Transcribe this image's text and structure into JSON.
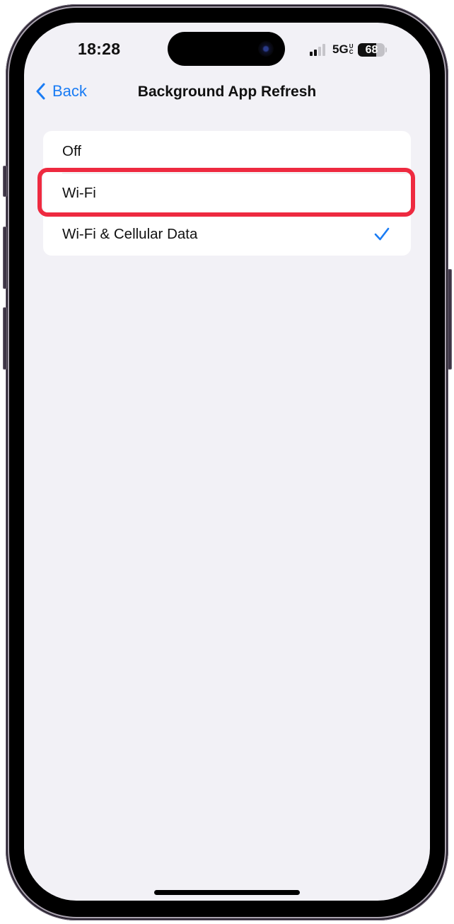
{
  "status_bar": {
    "time": "18:28",
    "signal_bars_active": 2,
    "signal_bars_total": 4,
    "network": "5G",
    "network_suffix_top": "U",
    "network_suffix_bottom": "C",
    "battery_percent": 68,
    "battery_label": "68"
  },
  "nav": {
    "back_label": "Back",
    "back_icon": "chevron-left-icon",
    "title": "Background App Refresh"
  },
  "options": [
    {
      "label": "Off",
      "selected": false
    },
    {
      "label": "Wi-Fi",
      "selected": false,
      "highlighted": true
    },
    {
      "label": "Wi-Fi & Cellular Data",
      "selected": true
    }
  ],
  "colors": {
    "accent": "#1a7cf4",
    "highlight": "#ee2a40",
    "background": "#f2f1f6",
    "card": "#ffffff",
    "text": "#111111"
  }
}
